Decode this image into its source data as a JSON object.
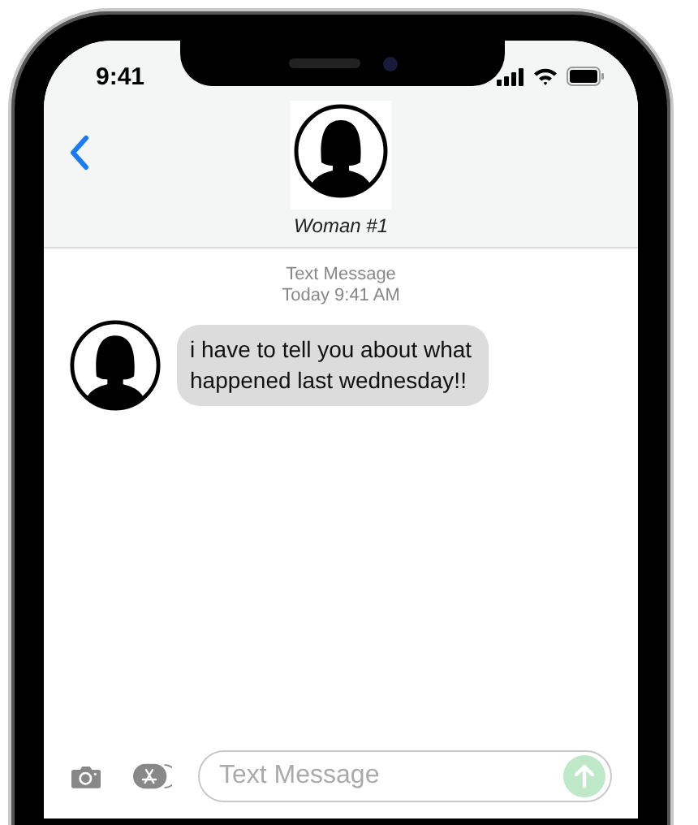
{
  "status_bar": {
    "time": "9:41"
  },
  "header": {
    "contact_name": "Woman #1"
  },
  "thread": {
    "label": "Text Message",
    "timestamp": "Today 9:41 AM"
  },
  "messages": [
    {
      "text": "i have to tell you about what happened last wednesday!!"
    }
  ],
  "composer": {
    "placeholder": "Text Message"
  }
}
